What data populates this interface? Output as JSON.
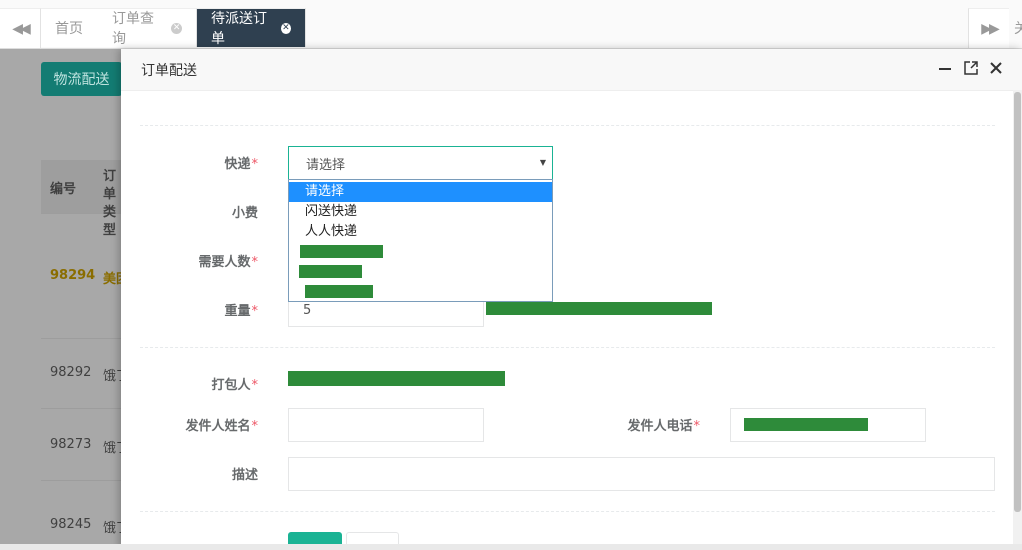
{
  "tabs": {
    "items": [
      {
        "label": "首页",
        "closable": false,
        "active": false
      },
      {
        "label": "订单查询",
        "closable": true,
        "active": false
      },
      {
        "label": "待派送订单",
        "closable": true,
        "active": true
      }
    ],
    "more_label": "关"
  },
  "background_page": {
    "button_label": "物流配送",
    "table": {
      "headers": [
        "编号",
        "订单类型"
      ],
      "rows": [
        {
          "id": "98294",
          "type": "美团"
        },
        {
          "id": "98292",
          "type": "饿了么"
        },
        {
          "id": "98273",
          "type": "饿了么"
        },
        {
          "id": "98245",
          "type": "饿了么"
        }
      ]
    }
  },
  "modal": {
    "title": "订单配送",
    "express": {
      "label": "快递",
      "required": true,
      "value": "请选择",
      "options": [
        "请选择",
        "闪送快递",
        "人人快递",
        "",
        "",
        ""
      ],
      "selected_index": 0
    },
    "tip": {
      "label": "小费"
    },
    "people": {
      "label": "需要人数",
      "required": true
    },
    "weight": {
      "label": "重量",
      "required": true,
      "value": "5"
    },
    "packer": {
      "label": "打包人",
      "required": true
    },
    "sender_name": {
      "label": "发件人姓名",
      "required": true,
      "value": ""
    },
    "sender_phone": {
      "label": "发件人电话",
      "required": true
    },
    "description": {
      "label": "描述",
      "value": ""
    },
    "required_mark": "*"
  },
  "colors": {
    "accent": "#1ab394",
    "tab_active_bg": "#2f4050",
    "required": "#ed5565",
    "dropdown_selected": "#1e90ff",
    "redaction": "#2e8b3a"
  }
}
